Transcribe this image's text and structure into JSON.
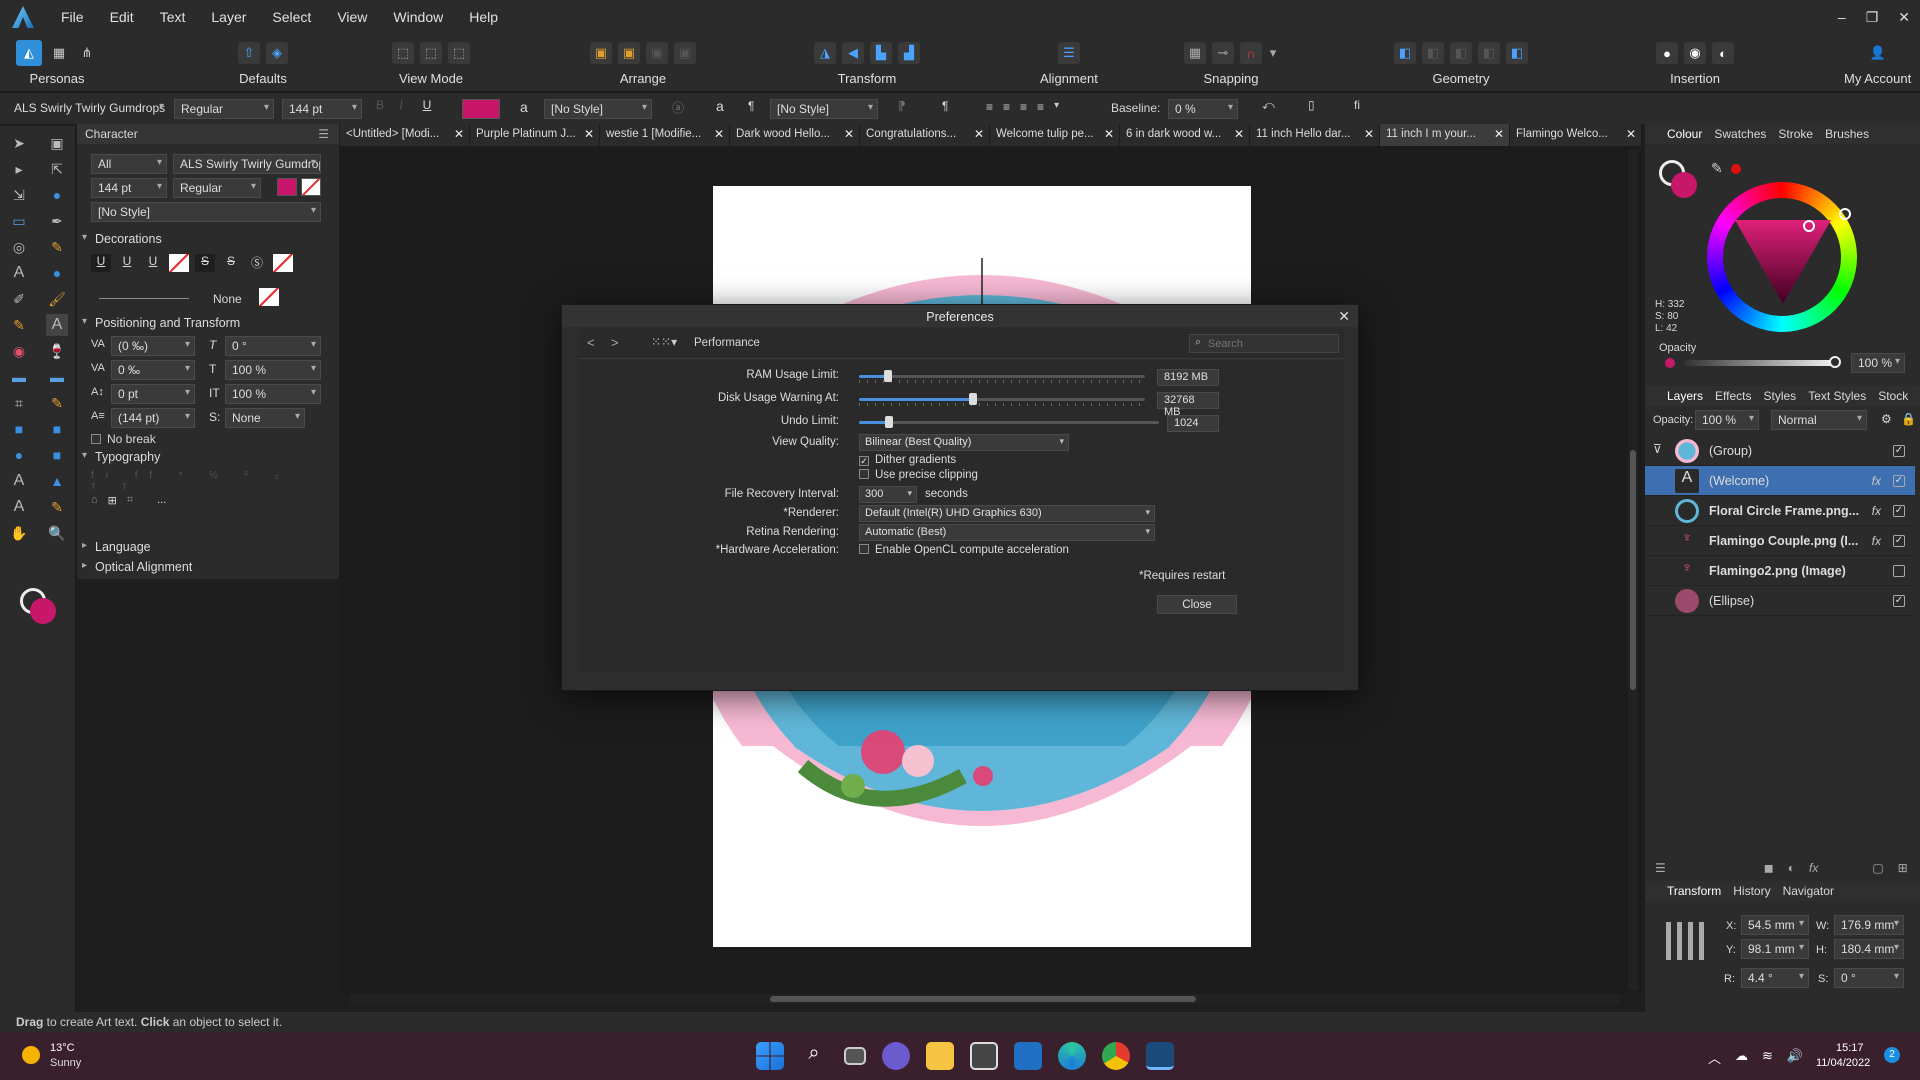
{
  "menu": [
    "File",
    "Edit",
    "Text",
    "Layer",
    "Select",
    "View",
    "Window",
    "Help"
  ],
  "toolbar": {
    "personas": "Personas",
    "defaults": "Defaults",
    "view_mode": "View Mode",
    "arrange": "Arrange",
    "transform": "Transform",
    "alignment": "Alignment",
    "snapping": "Snapping",
    "geometry": "Geometry",
    "insertion": "Insertion",
    "my_account": "My Account"
  },
  "context": {
    "font": "ALS Swirly Twirly Gumdrops",
    "style": "Regular",
    "size": "144 pt",
    "char_style": "[No Style]",
    "para_style": "[No Style]",
    "baseline_label": "Baseline:",
    "baseline": "0 %",
    "accent": "#c8176a"
  },
  "character": {
    "tab": "Character",
    "scope": "All",
    "font": "ALS Swirly Twirly Gumdrop",
    "size": "144 pt",
    "style": "Regular",
    "char_style": "[No Style]",
    "decorations": "Decorations",
    "dec_none": "None",
    "positioning": "Positioning and Transform",
    "tracking": "(0 ‰)",
    "kerning": "0 ‰",
    "baseline": "0 pt",
    "leading": "(144 pt)",
    "slant": "0 °",
    "vscale": "100 %",
    "hscale": "100 %",
    "s_label": "S:",
    "s_value": "None",
    "no_break": "No break",
    "typography": "Typography",
    "more": "...",
    "language": "Language",
    "optical": "Optical Alignment"
  },
  "tabs": [
    "<Untitled> [Modi...",
    "Purple Platinum J...",
    "westie 1 [Modifie...",
    "Dark wood Hello...",
    "Congratulations...",
    "Welcome tulip pe...",
    "6 in dark wood w...",
    "11 inch Hello dar...",
    "11 inch I m your...",
    "Flamingo Welco..."
  ],
  "right": {
    "tabs1": [
      "Colour",
      "Swatches",
      "Stroke",
      "Brushes"
    ],
    "h": "H: 332",
    "s": "S: 80",
    "l": "L: 42",
    "opacity_label": "Opacity",
    "opacity": "100 %",
    "tabs2": [
      "Layers",
      "Effects",
      "Styles",
      "Text Styles",
      "Stock"
    ],
    "layer_opacity_label": "Opacity:",
    "layer_opacity": "100 %",
    "blend": "Normal",
    "layers": [
      {
        "name": "(Group)",
        "checked": "✓"
      },
      {
        "name": "(Welcome)",
        "checked": "✓"
      },
      {
        "name": "Floral Circle Frame.png...",
        "checked": "✓"
      },
      {
        "name": "Flamingo Couple.png (I...",
        "checked": "✓"
      },
      {
        "name": "Flamingo2.png (Image)",
        "checked": ""
      },
      {
        "name": "(Ellipse)",
        "checked": "✓"
      }
    ],
    "tabs3": [
      "Transform",
      "History",
      "Navigator"
    ],
    "x_label": "X:",
    "x": "54.5 mm",
    "y_label": "Y:",
    "y": "98.1 mm",
    "w_label": "W:",
    "w": "176.9 mm",
    "hh_label": "H:",
    "hh": "180.4 mm",
    "r_label": "R:",
    "r": "4.4 °",
    "sk_label": "S:",
    "sk": "0 °"
  },
  "status": {
    "drag": "Drag",
    "text1": " to create Art text. ",
    "click": "Click",
    "text2": " an object to select it."
  },
  "taskbar": {
    "temp": "13°C",
    "weather": "Sunny",
    "time": "15:17",
    "date": "11/04/2022",
    "badge": "2"
  },
  "dialog": {
    "title": "Preferences",
    "section": "Performance",
    "search_placeholder": "Search",
    "ram_label": "RAM Usage Limit:",
    "ram_value": "8192 MB",
    "ram_level": 0.1,
    "disk_label": "Disk Usage Warning At:",
    "disk_value": "32768 MB",
    "disk_level": 0.4,
    "undo_label": "Undo Limit:",
    "undo_value": "1024",
    "undo_level": 0.1,
    "quality_label": "View Quality:",
    "quality_value": "Bilinear (Best Quality)",
    "dither": "Dither gradients",
    "clipping": "Use precise clipping",
    "recovery_label": "File Recovery Interval:",
    "recovery_value": "300",
    "recovery_unit": "seconds",
    "renderer_label": "*Renderer:",
    "renderer_value": "Default (Intel(R) UHD Graphics 630)",
    "retina_label": "Retina Rendering:",
    "retina_value": "Automatic (Best)",
    "hw_label": "*Hardware Acceleration:",
    "hw_value": "Enable OpenCL compute acceleration",
    "restart_note": "*Requires restart",
    "close": "Close"
  }
}
